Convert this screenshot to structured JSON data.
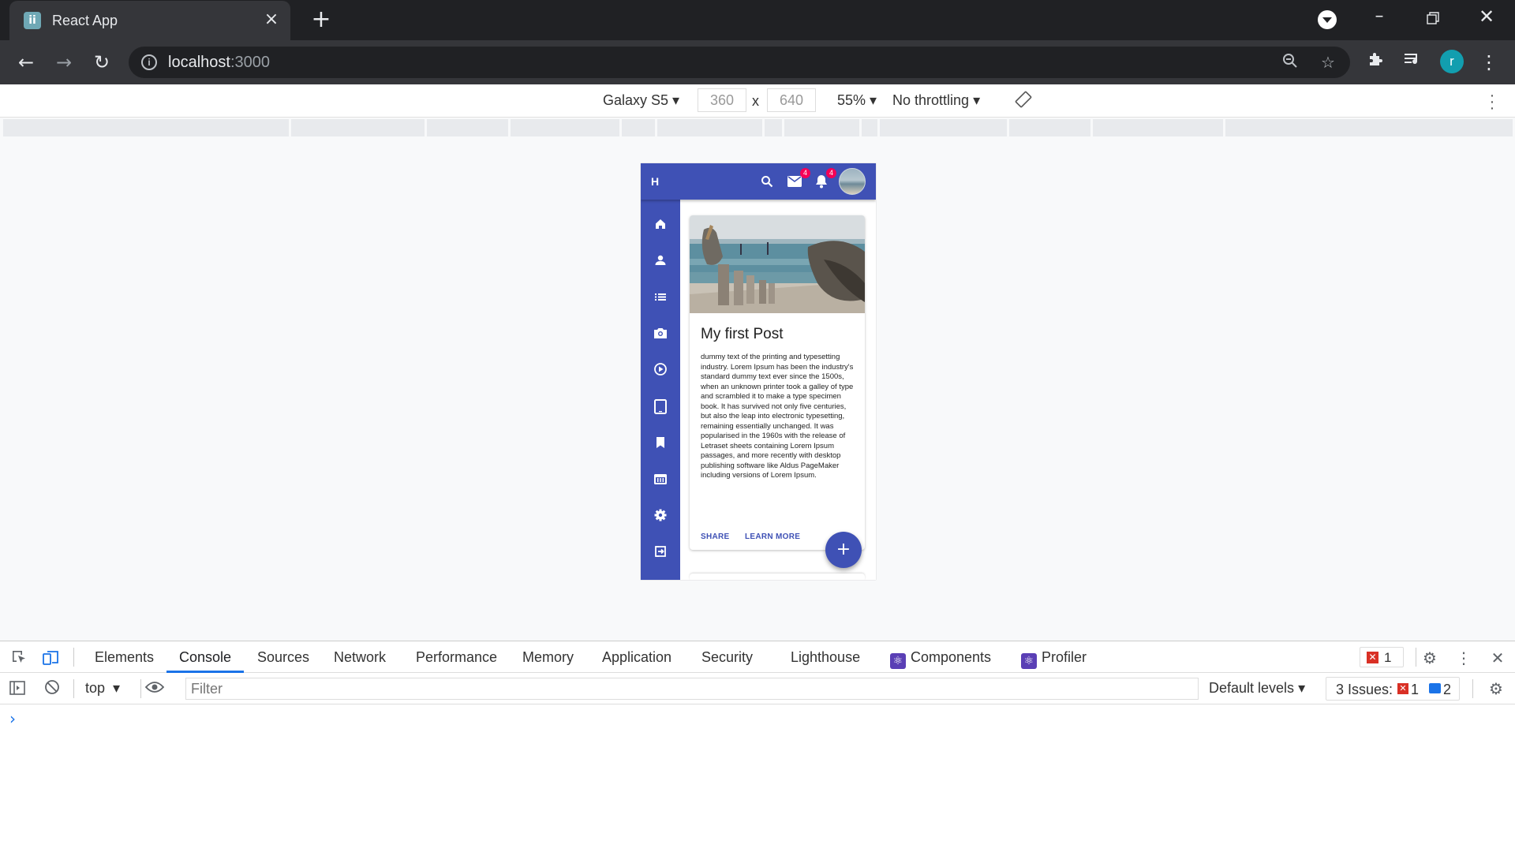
{
  "browser": {
    "tab_title": "React App",
    "tab_favicon": "ii",
    "url_host": "localhost",
    "url_port": ":3000"
  },
  "device_toolbar": {
    "device": "Galaxy S5",
    "width": "360",
    "by": "x",
    "height": "640",
    "zoom": "55%",
    "throttling": "No throttling"
  },
  "app": {
    "logo": "H",
    "mail_badge": "4",
    "notification_badge": "4",
    "sidebar_icons": [
      "home-icon",
      "person-icon",
      "list-icon",
      "camera-icon",
      "play-circle-icon",
      "tablet-icon",
      "bookmark-icon",
      "store-icon",
      "settings-icon",
      "logout-icon"
    ],
    "post": {
      "title": "My first Post",
      "body": "dummy text of the printing and typesetting industry. Lorem Ipsum has been the industry's standard dummy text ever since the 1500s, when an unknown printer took a galley of type and scrambled it to make a type specimen book. It has survived not only five centuries, but also the leap into electronic typesetting, remaining essentially unchanged. It was popularised in the 1960s with the release of Letraset sheets containing Lorem Ipsum passages, and more recently with desktop publishing software like Aldus PageMaker including versions of Lorem Ipsum.",
      "share_label": "SHARE",
      "learn_more_label": "LEARN MORE"
    },
    "fab_label": "+",
    "accent_color": "#3f51b5"
  },
  "devtools": {
    "tabs": [
      "Elements",
      "Console",
      "Sources",
      "Network",
      "Performance",
      "Memory",
      "Application",
      "Security",
      "Lighthouse",
      "Components",
      "Profiler"
    ],
    "active_tab": "Console",
    "error_count": "1",
    "context": "top",
    "filter_placeholder": "Filter",
    "levels": "Default levels",
    "issues_label": "3 Issues:",
    "issues_errors": "1",
    "issues_info": "2",
    "prompt": "›"
  }
}
